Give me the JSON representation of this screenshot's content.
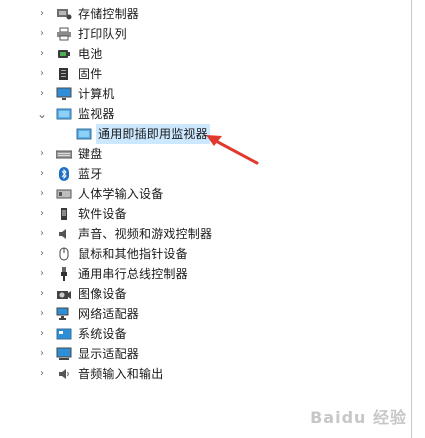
{
  "devices": [
    {
      "label": "存储控制器",
      "icon": "storage-controller-icon",
      "expanded": false
    },
    {
      "label": "打印队列",
      "icon": "printer-icon",
      "expanded": false
    },
    {
      "label": "电池",
      "icon": "battery-icon",
      "expanded": false
    },
    {
      "label": "固件",
      "icon": "firmware-icon",
      "expanded": false
    },
    {
      "label": "计算机",
      "icon": "computer-icon",
      "expanded": false
    },
    {
      "label": "监视器",
      "icon": "monitor-icon",
      "expanded": true,
      "children": [
        {
          "label": "通用即插即用监视器",
          "icon": "monitor-icon",
          "selected": true
        }
      ]
    },
    {
      "label": "键盘",
      "icon": "keyboard-icon",
      "expanded": false
    },
    {
      "label": "蓝牙",
      "icon": "bluetooth-icon",
      "expanded": false
    },
    {
      "label": "人体学输入设备",
      "icon": "hid-icon",
      "expanded": false
    },
    {
      "label": "软件设备",
      "icon": "software-device-icon",
      "expanded": false
    },
    {
      "label": "声音、视频和游戏控制器",
      "icon": "speaker-icon",
      "expanded": false
    },
    {
      "label": "鼠标和其他指针设备",
      "icon": "mouse-icon",
      "expanded": false
    },
    {
      "label": "通用串行总线控制器",
      "icon": "usb-icon",
      "expanded": false
    },
    {
      "label": "图像设备",
      "icon": "camera-icon",
      "expanded": false
    },
    {
      "label": "网络适配器",
      "icon": "network-adapter-icon",
      "expanded": false
    },
    {
      "label": "系统设备",
      "icon": "system-device-icon",
      "expanded": false
    },
    {
      "label": "显示适配器",
      "icon": "display-adapter-icon",
      "expanded": false
    },
    {
      "label": "音频输入和输出",
      "icon": "audio-io-icon",
      "expanded": false
    }
  ],
  "watermark": "Baidu 经验",
  "colors": {
    "selection": "#cce8ff",
    "arrow": "#e03a2f",
    "monitor_blue": "#2f8fd6"
  }
}
